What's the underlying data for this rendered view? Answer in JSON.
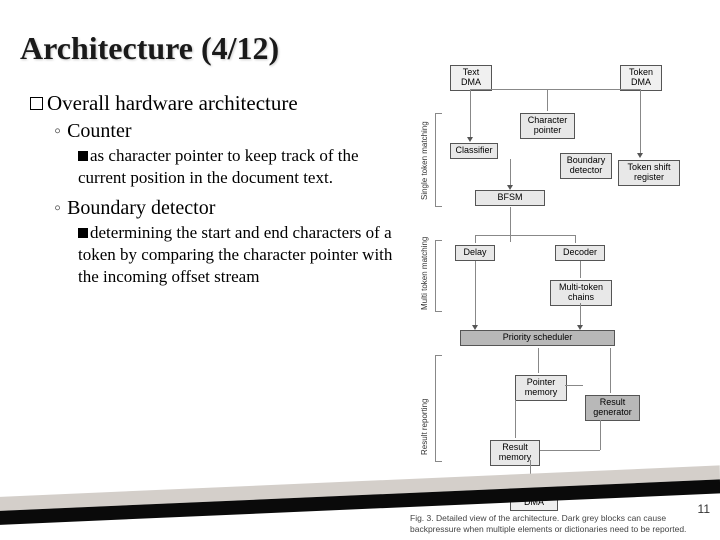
{
  "title": "Architecture (4/12)",
  "bullets": {
    "main": "Overall hardware architecture",
    "counter": {
      "label": "Counter",
      "desc": "as character pointer to keep track of the current position in the document text."
    },
    "boundary": {
      "label": "Boundary detector",
      "desc": "determining the start and end characters of a token by comparing the character pointer with the incoming offset stream"
    }
  },
  "page_number": "11",
  "diagram": {
    "text_dma": "Text\nDMA",
    "token_dma": "Token\nDMA",
    "char_ptr": "Character\npointer",
    "classifier": "Classifier",
    "boundary": "Boundary\ndetector",
    "token_shift": "Token\nshift register",
    "bfsm": "BFSM",
    "delay": "Delay",
    "decoder": "Decoder",
    "multi_chain": "Multi-token\nchains",
    "priority": "Priority\nscheduler",
    "ptr_mem": "Pointer\nmemory",
    "result_gen": "Result\ngenerator",
    "result_mem": "Result\nmemory",
    "result_dma": "Result\nDMA",
    "label_single": "Single token\nmatching",
    "label_multi": "Multi token\nmatching",
    "label_result": "Result reporting",
    "caption": "Fig. 3. Detailed view of the architecture. Dark grey blocks can cause backpressure when multiple elements or dictionaries need to be reported."
  }
}
